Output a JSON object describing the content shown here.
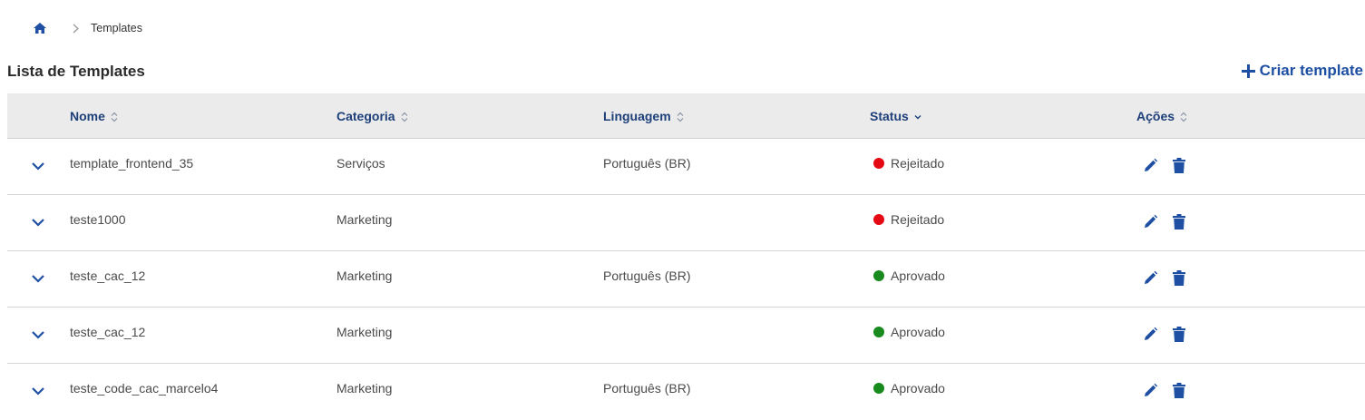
{
  "breadcrumb": {
    "current": "Templates"
  },
  "page": {
    "title": "Lista de Templates",
    "create_label": "Criar template"
  },
  "colors": {
    "accent": "#1f4fa3",
    "rejected": "#e50914",
    "approved": "#188a1e"
  },
  "table": {
    "headers": {
      "nome": "Nome",
      "categoria": "Categoria",
      "linguagem": "Linguagem",
      "status": "Status",
      "acoes": "Ações"
    },
    "rows": [
      {
        "nome": "template_frontend_35",
        "categoria": "Serviços",
        "linguagem": "Português (BR)",
        "status": "Rejeitado"
      },
      {
        "nome": "teste1000",
        "categoria": "Marketing",
        "linguagem": "",
        "status": "Rejeitado"
      },
      {
        "nome": "teste_cac_12",
        "categoria": "Marketing",
        "linguagem": "Português (BR)",
        "status": "Aprovado"
      },
      {
        "nome": "teste_cac_12",
        "categoria": "Marketing",
        "linguagem": "",
        "status": "Aprovado"
      },
      {
        "nome": "teste_code_cac_marcelo4",
        "categoria": "Marketing",
        "linguagem": "Português (BR)",
        "status": "Aprovado"
      }
    ]
  }
}
